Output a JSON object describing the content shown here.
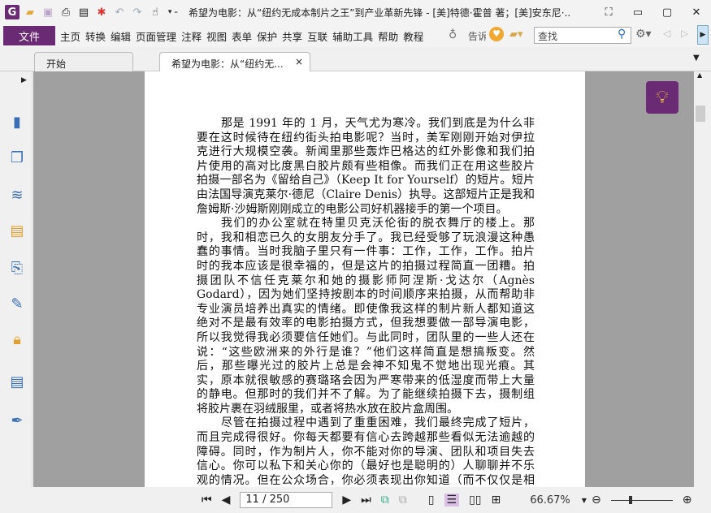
{
  "window": {
    "title": "希望为电影：从“纽约无成本制片之王”到产业革新先锋 - [美]特德·霍普 著；[美]安东尼·...",
    "min": "▭",
    "max": "▢",
    "close": "✕",
    "full": "⛶"
  },
  "menu": {
    "file": "文件",
    "items": [
      "主页",
      "转换",
      "编辑",
      "页面管理",
      "注释",
      "视图",
      "表单",
      "保护",
      "共享",
      "互联",
      "辅助工具",
      "帮助",
      "教程"
    ],
    "tell": "告诉",
    "search_placeholder": "查找"
  },
  "tabs": [
    {
      "label": "开始"
    },
    {
      "label": "希望为电影：从“纽约无...",
      "close": "×"
    }
  ],
  "doc": {
    "lines": [
      {
        "t": "那是 1991 年的 1 月，天气尤为寒冷。我们到底是为什么非",
        "c": "j ind"
      },
      {
        "t": "要在这时候待在纽约街头拍电影呢？当时，美军刚刚开始对伊拉",
        "c": "j"
      },
      {
        "t": "克进行大规模空袭。新闻里那些轰炸巴格达的红外影像和我们拍",
        "c": "j"
      },
      {
        "t": "片使用的高对比度黑白胶片颇有些相像。而我们正在用这些胶片",
        "c": "j"
      },
      {
        "t": "拍摄一部名为《留给自己》（Keep It for Yourself）的短片。短片",
        "c": "j"
      },
      {
        "t": "由法国导演克莱尔·德尼（Claire Denis）执导。这部短片正是我和",
        "c": "j"
      },
      {
        "t": "詹姆斯·沙姆斯刚刚成立的电影公司好机器接手的第一个项目。",
        "c": ""
      },
      {
        "t": "我们的办公室就在特里贝克沃伦街的脱衣舞厅的楼上。那",
        "c": "j ind"
      },
      {
        "t": "时，我和相恋已久的女朋友分手了。我已经受够了玩浪漫这种愚",
        "c": "j"
      },
      {
        "t": "蠢的事情。当时我脑子里只有一件事：工作，工作，工作。拍片",
        "c": "j"
      },
      {
        "t": "时的我本应该是很幸福的，但是这片的拍摄过程简直一团糟。拍",
        "c": "j"
      },
      {
        "t": "摄团队不信任克莱尔和她的摄影师阿涅斯·戈达尔（Agnès",
        "c": "j"
      },
      {
        "t": "Godard），因为她们坚持按剧本的时间顺序来拍摄，从而帮助非",
        "c": "j"
      },
      {
        "t": "专业演员培养出真实的情绪。即使像我这样的制片新人都知道这",
        "c": "j"
      },
      {
        "t": "绝对不是最有效率的电影拍摄方式，但我想要做一部导演电影，",
        "c": "j"
      },
      {
        "t": "所以我觉得我必须要信任她们。与此同时，团队里的一些人还在",
        "c": "j"
      },
      {
        "t": "说：“这些欧洲来的外行是谁？”他们这样简直是想搞叛变。然",
        "c": "j"
      },
      {
        "t": "后，那些曝光过的胶片上总是会神不知鬼不觉地出现光痕。其",
        "c": "j"
      },
      {
        "t": "实，原本就很敏感的赛璐珞会因为严寒带来的低湿度而带上大量",
        "c": "j"
      },
      {
        "t": "的静电。但那时的我们并不了解。为了能继续拍摄下去，摄制组",
        "c": "j"
      },
      {
        "t": "将胶片裹在羽绒服里，或者将热水放在胶片盒周围。",
        "c": ""
      },
      {
        "t": "尽管在拍摄过程中遇到了重重困难，我们最终完成了短片，",
        "c": "j ind"
      },
      {
        "t": "而且完成得很好。你每天都要有信心去跨越那些看似无法逾越的",
        "c": "j"
      },
      {
        "t": "障碍。同时，作为制片人，你不能对你的导演、团队和项目失去",
        "c": "j"
      },
      {
        "t": "信心。你可以私下和关心你的（最好也是聪明的）人聊聊并不乐",
        "c": "j"
      },
      {
        "t": "观的情况。但在公众场合，你必须表现出你知道（而不仅仅是相",
        "c": "j"
      }
    ]
  },
  "status": {
    "page": "11 / 250",
    "zoom": "66.67%"
  },
  "colors": {
    "accent": "#6b2b74"
  }
}
